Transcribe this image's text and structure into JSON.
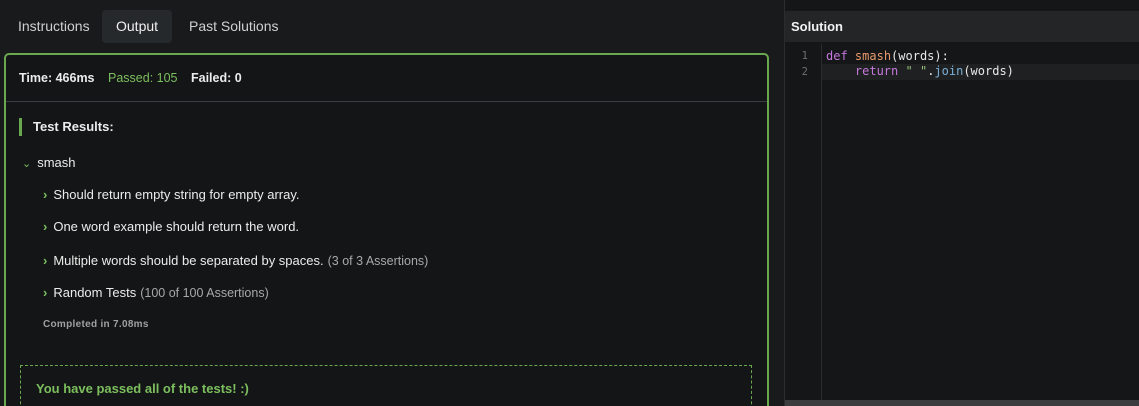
{
  "tabs": [
    {
      "label": "Instructions"
    },
    {
      "label": "Output"
    },
    {
      "label": "Past Solutions"
    }
  ],
  "stats": {
    "time": "Time: 466ms",
    "passed": "Passed: 105",
    "failed": "Failed: 0"
  },
  "results": {
    "header": "Test Results:",
    "describe": "smash",
    "tests": [
      {
        "label": "Should return empty string for empty array.",
        "assertions": ""
      },
      {
        "label": "One word example should return the word.",
        "assertions": ""
      },
      {
        "label": "Multiple words should be separated by spaces.",
        "assertions": "(3 of 3 Assertions)"
      },
      {
        "label": "Random Tests",
        "assertions": "(100 of 100 Assertions)"
      }
    ],
    "completed": "Completed in 7.08ms",
    "pass_message": "You have passed all of the tests! :)"
  },
  "solution": {
    "title": "Solution",
    "line_numbers": [
      "1",
      "2"
    ],
    "code": {
      "l1_kw": "def",
      "l1_fn": "smash",
      "l1_rest": "(words):",
      "l2_kw": "return",
      "l2_str": "\" \"",
      "l2_dot": ".",
      "l2_mth": "join",
      "l2_rest": "(words)"
    }
  },
  "icons": {
    "describe_chevron": "chevron-down-icon",
    "test_chevron": "chevron-right-icon"
  },
  "colors": {
    "accent_green": "#6aa84f",
    "pass_green": "#7cbf5e",
    "background": "#181a1b"
  }
}
